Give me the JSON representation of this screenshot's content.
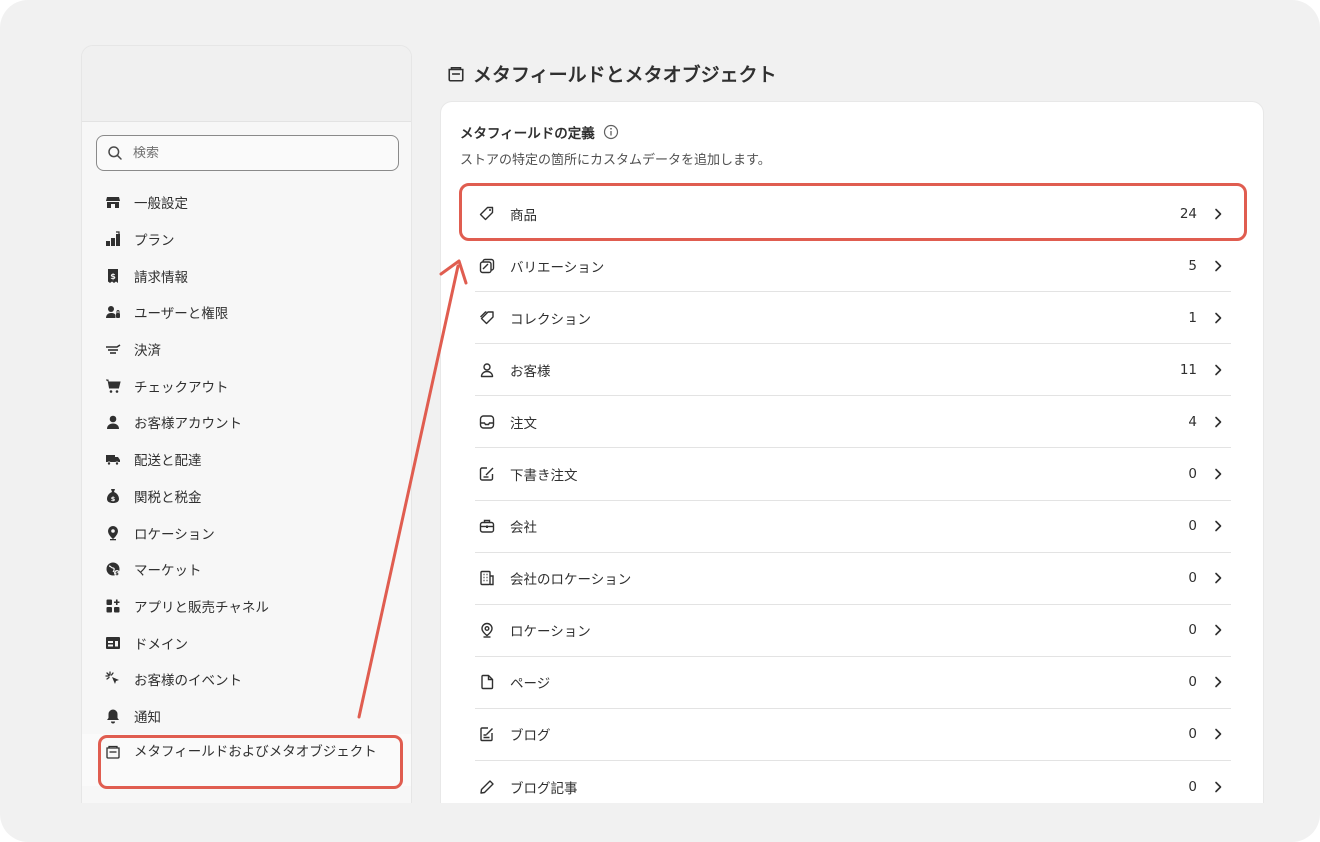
{
  "sidebar": {
    "search": {
      "placeholder": "検索",
      "value": ""
    },
    "items": [
      {
        "label": "一般設定",
        "icon": "store-icon"
      },
      {
        "label": "プラン",
        "icon": "plan-icon"
      },
      {
        "label": "請求情報",
        "icon": "billing-icon"
      },
      {
        "label": "ユーザーと権限",
        "icon": "users-icon"
      },
      {
        "label": "決済",
        "icon": "payments-icon"
      },
      {
        "label": "チェックアウト",
        "icon": "cart-icon"
      },
      {
        "label": "お客様アカウント",
        "icon": "person-icon"
      },
      {
        "label": "配送と配達",
        "icon": "truck-icon"
      },
      {
        "label": "関税と税金",
        "icon": "money-bag-icon"
      },
      {
        "label": "ロケーション",
        "icon": "location-icon"
      },
      {
        "label": "マーケット",
        "icon": "globe-icon"
      },
      {
        "label": "アプリと販売チャネル",
        "icon": "apps-icon"
      },
      {
        "label": "ドメイン",
        "icon": "domain-icon"
      },
      {
        "label": "お客様のイベント",
        "icon": "cursor-click-icon"
      },
      {
        "label": "通知",
        "icon": "bell-icon"
      },
      {
        "label": "メタフィールドおよびメタオブジェクト",
        "icon": "metafields-icon",
        "active": true
      }
    ]
  },
  "page": {
    "title": "メタフィールドとメタオブジェクト",
    "title_icon": "metafields-icon"
  },
  "card": {
    "heading": "メタフィールドの定義",
    "subtitle": "ストアの特定の箇所にカスタムデータを追加します。",
    "rows": [
      {
        "label": "商品",
        "count": "24",
        "icon": "tag-icon"
      },
      {
        "label": "バリエーション",
        "count": "5",
        "icon": "variant-icon"
      },
      {
        "label": "コレクション",
        "count": "1",
        "icon": "collection-icon"
      },
      {
        "label": "お客様",
        "count": "11",
        "icon": "person-icon"
      },
      {
        "label": "注文",
        "count": "4",
        "icon": "inbox-icon"
      },
      {
        "label": "下書き注文",
        "count": "0",
        "icon": "draft-order-icon"
      },
      {
        "label": "会社",
        "count": "0",
        "icon": "company-icon"
      },
      {
        "label": "会社のロケーション",
        "count": "0",
        "icon": "building-icon"
      },
      {
        "label": "ロケーション",
        "count": "0",
        "icon": "location-icon"
      },
      {
        "label": "ページ",
        "count": "0",
        "icon": "page-icon"
      },
      {
        "label": "ブログ",
        "count": "0",
        "icon": "blog-icon"
      },
      {
        "label": "ブログ記事",
        "count": "0",
        "icon": "pen-icon"
      }
    ]
  },
  "colors": {
    "frame_bg": "#f1f1f1",
    "annotation": "#e05d50",
    "text": "#303030"
  }
}
